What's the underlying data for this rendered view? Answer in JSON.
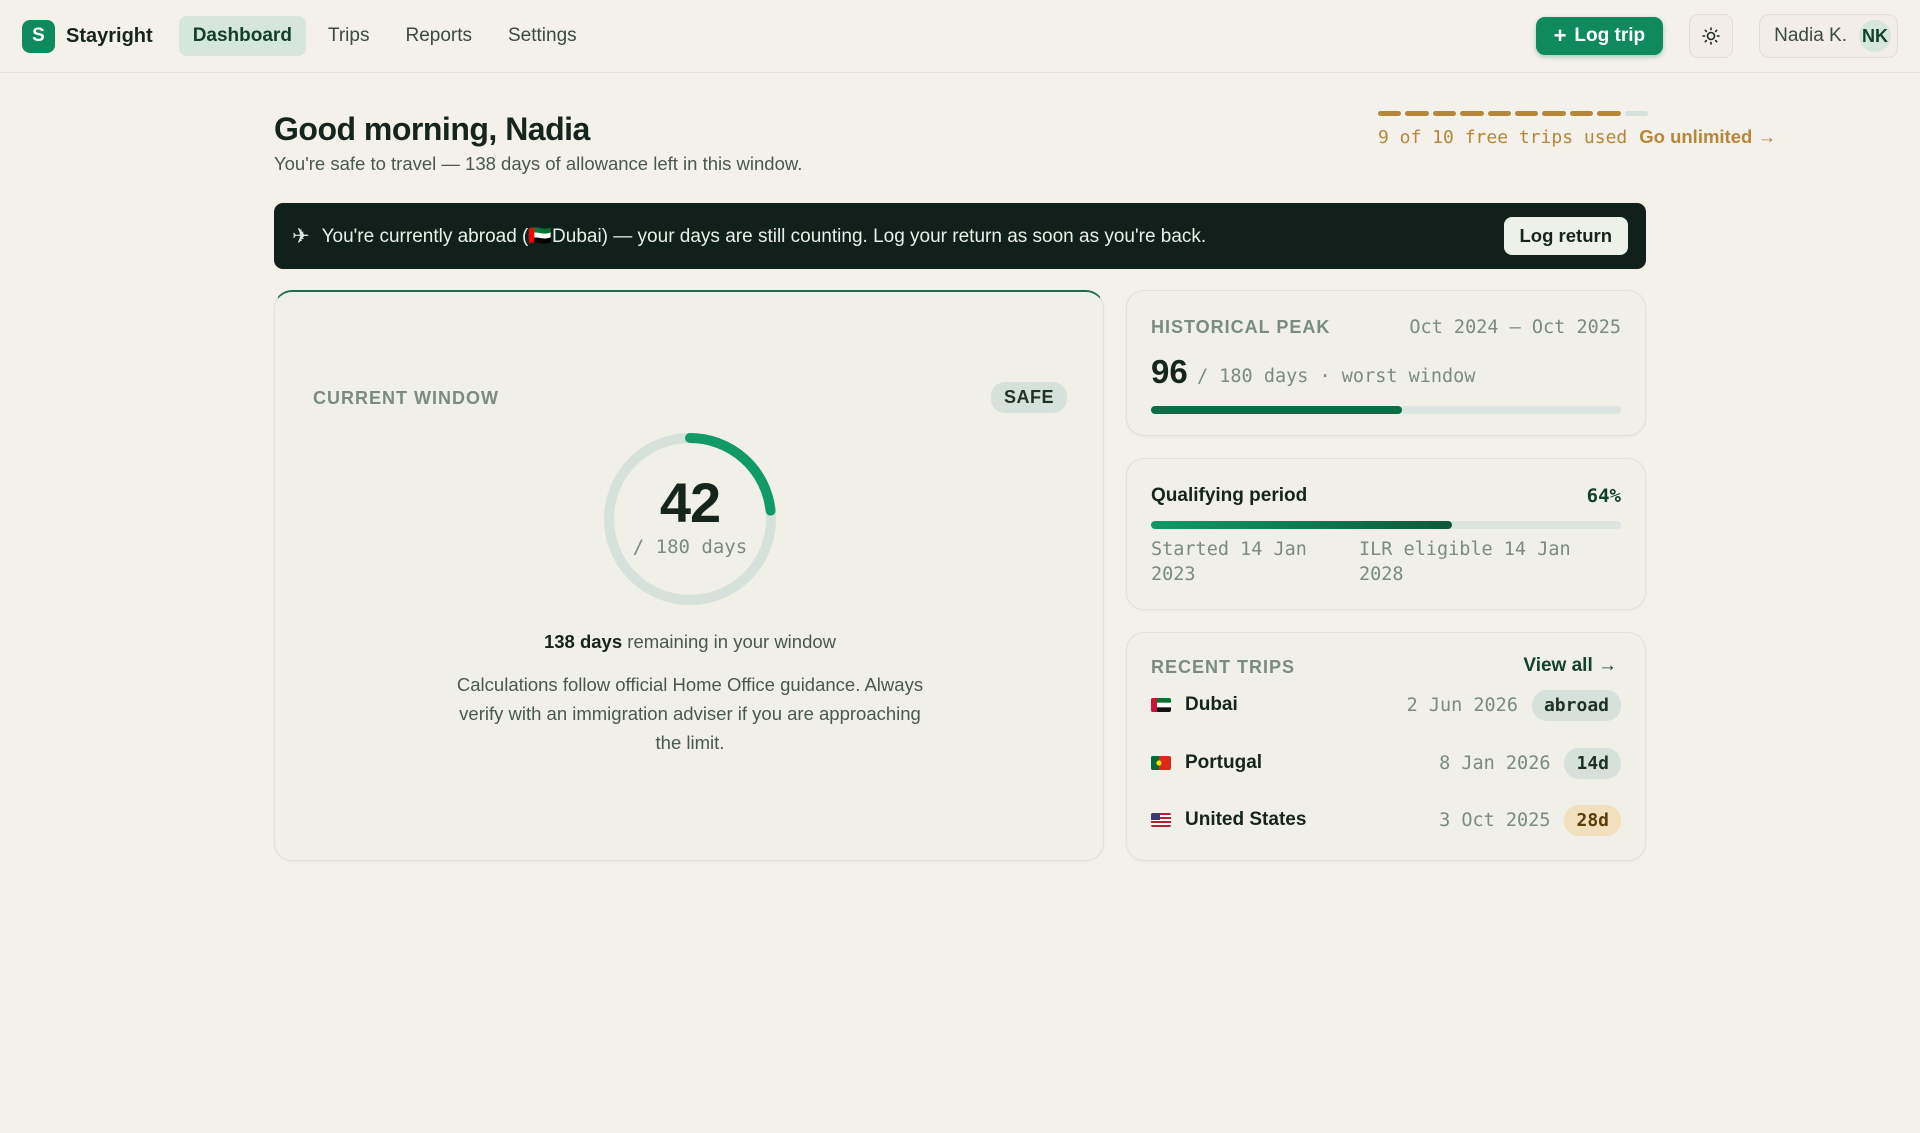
{
  "app": {
    "logo_letter": "S",
    "name": "Stayright"
  },
  "nav": {
    "items": [
      "Dashboard",
      "Trips",
      "Reports",
      "Settings"
    ],
    "active": "Dashboard"
  },
  "header": {
    "log_trip_label": "Log trip",
    "user_name": "Nadia K.",
    "user_initials": "NK"
  },
  "greeting": {
    "title": "Good morning, Nadia",
    "subtitle": "You're safe to travel — 138 days of allowance left in this window."
  },
  "usage": {
    "used": 9,
    "total": 10,
    "text": "9 of 10 free trips used",
    "link": "Go unlimited →"
  },
  "alert": {
    "icon": "plane-icon",
    "text": "You're currently abroad (🇦🇪Dubai) — your days are still counting. Log your return as soon as you're back.",
    "button": "Log return"
  },
  "current_window": {
    "label": "CURRENT WINDOW",
    "badge": "SAFE",
    "days_used": "42",
    "limit_text": "/ 180 days",
    "used_fraction": 0.2333,
    "remaining_bold": "138 days",
    "remaining_text": " remaining in your window",
    "disclaimer": "Calculations follow official Home Office guidance. Always verify with an immigration adviser if you are approaching the limit."
  },
  "historical_peak": {
    "label": "HISTORICAL PEAK",
    "range": "Oct 2024 – Oct 2025",
    "value": "96",
    "sub": "/ 180 days · worst window",
    "fraction": 0.5333
  },
  "qualifying": {
    "title": "Qualifying period",
    "percent_text": "64%",
    "fraction": 0.64,
    "started": "Started 14 Jan 2023",
    "eligible": "ILR eligible 14 Jan 2028"
  },
  "recent_trips": {
    "label": "RECENT TRIPS",
    "link": "View all →",
    "items": [
      {
        "country": "Dubai",
        "date": "2 Jun 2026",
        "status": "abroad",
        "flag": "uae-flag-icon"
      },
      {
        "country": "Portugal",
        "date": "8 Jan 2026",
        "status": "14d",
        "flag": "portugal-flag-icon"
      },
      {
        "country": "United States",
        "date": "3 Oct 2025",
        "status": "28d",
        "flag": "us-flag-icon"
      }
    ]
  },
  "colors": {
    "accent": "#0f8a5f",
    "warning": "#b6863a",
    "dark_banner": "#10201a"
  }
}
